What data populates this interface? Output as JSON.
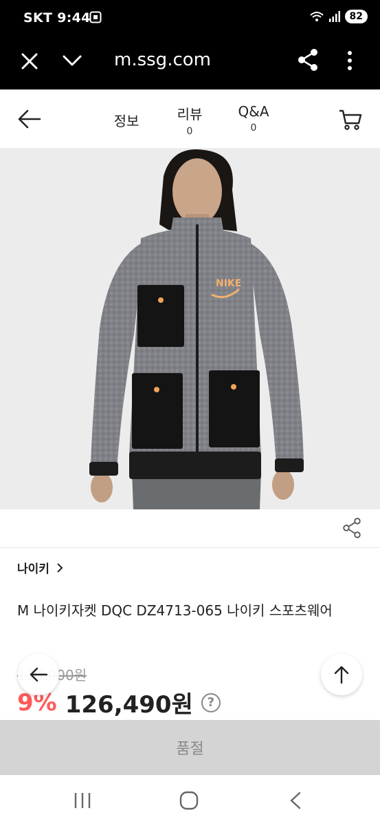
{
  "status_bar": {
    "carrier": "SKT",
    "time": "9:44",
    "battery": "82"
  },
  "browser": {
    "url": "m.ssg.com",
    "icons": [
      "close-icon",
      "chevron-down-icon",
      "share-icon",
      "more-vertical-icon"
    ]
  },
  "header": {
    "tabs": [
      {
        "label": "정보",
        "count": ""
      },
      {
        "label": "리뷰",
        "count": "0"
      },
      {
        "label": "Q&A",
        "count": "0"
      }
    ]
  },
  "product": {
    "brand": "나이키",
    "title": "M 나이키자켓 DQC DZ4713-065 나이키 스포츠웨어",
    "original_price": "139,000원",
    "discount": "9%",
    "price": "126,490원",
    "help": "?"
  },
  "buy": {
    "label": "품절"
  },
  "colors": {
    "sale": "#ff5a5a",
    "soldout_bg": "#d4d4d4",
    "jacket": "#7d7f84"
  }
}
